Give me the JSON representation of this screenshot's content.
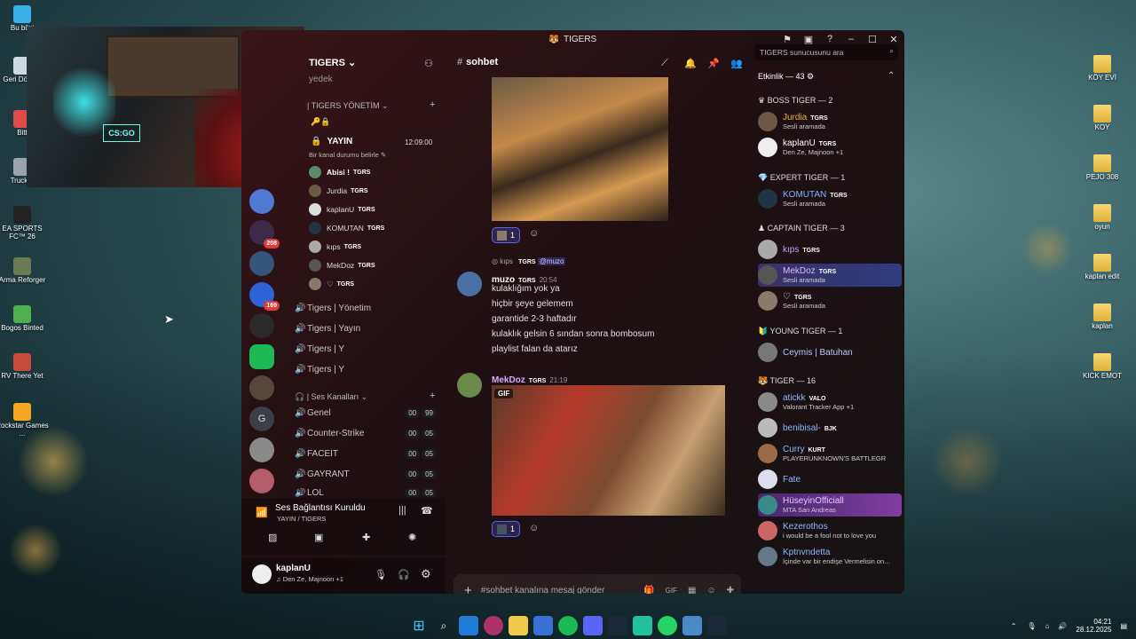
{
  "desktop": {
    "left_icons": [
      "Bu bilgi",
      "Geri Dönü...",
      "Bitt",
      "Trucker",
      "EA SPORTS FC™ 26",
      "Arma Reforger",
      "Bogos Binted",
      "RV There Yet",
      "Rockstar Games ..."
    ],
    "right_icons": [
      "KÖY EVİ",
      "KOY",
      "PEJO 308",
      "oyun",
      "kaplan edit",
      "kaplan",
      "KICK EMOT"
    ]
  },
  "webcam": {
    "logo": "CS:GO"
  },
  "window": {
    "title": "TIGERS"
  },
  "servers": {
    "badges": [
      "208",
      "169"
    ],
    "letter": "G"
  },
  "channels": {
    "server_name": "TIGERS",
    "prev_channel": "yedek",
    "category_1": "TIGERS YÖNETİM",
    "live_title": "YAYIN",
    "live_time": "12:09:00",
    "live_status": "Bir kanal durumu belirle",
    "voice_users": [
      {
        "name": "Abisi !",
        "tag": "TGRS"
      },
      {
        "name": "Jurdia",
        "tag": "TGRS"
      },
      {
        "name": "kaplanU",
        "tag": "TGRS"
      },
      {
        "name": "KOMUTAN",
        "tag": "TGRS"
      },
      {
        "name": "kıps",
        "tag": "TGRS"
      },
      {
        "name": "MekDoz",
        "tag": "TGRS"
      },
      {
        "name": "♡",
        "tag": "TGRS"
      }
    ],
    "voice_channels": [
      "Tigers | Yönetim",
      "Tigers | Yayın",
      "Tigers | Y",
      "Tigers | Y"
    ],
    "category_2": "Ses Kanalları",
    "sound_channels": [
      {
        "name": "Genel",
        "a": "00",
        "b": "99"
      },
      {
        "name": "Counter-Strike",
        "a": "00",
        "b": "05"
      },
      {
        "name": "FACEIT",
        "a": "00",
        "b": "05"
      },
      {
        "name": "GAYRANT",
        "a": "00",
        "b": "05"
      },
      {
        "name": "LOL",
        "a": "00",
        "b": "05"
      }
    ]
  },
  "voice_panel": {
    "title": "Ses Bağlantısı Kuruldu",
    "sub": "YAYIN / TIGERS"
  },
  "user_panel": {
    "name": "kaplanU",
    "status": "Den Ze, Majnoon +1"
  },
  "chat": {
    "channel": "sohbet",
    "search_placeholder": "TIGERS sunucusunu ara",
    "reaction1": "1",
    "reply_author": "kıps",
    "reply_tag": "TGRS",
    "reply_mention": "@muzo",
    "msg1": {
      "author": "muzo",
      "tag": "TGRS",
      "time": "20:54",
      "lines": [
        "kulaklığım yok ya",
        "hiçbir şeye gelemem",
        "garantide 2-3 haftadır",
        "kulaklık gelsin 6 sından sonra bombosum",
        "playlist falan da atarız"
      ]
    },
    "msg2": {
      "author": "MekDoz",
      "tag": "TGRS",
      "time": "21:19",
      "gif": "GIF"
    },
    "reaction2": "1",
    "composer_placeholder": "#sohbet kanalına mesaj gönder"
  },
  "members": {
    "header": "Etkinlik — 43",
    "groups": [
      {
        "title": "BOSS TIGER — 2",
        "members": [
          {
            "name": "Jurdia",
            "tag": "TGRS",
            "status": "Sesli aramada",
            "color": "#f0b232"
          },
          {
            "name": "kaplanU",
            "tag": "TGRS",
            "status": "Den Ze, Majnoon +1",
            "color": "#ffffff"
          }
        ]
      },
      {
        "title": "EXPERT TIGER — 1",
        "members": [
          {
            "name": "KOMUTAN",
            "tag": "TGRS",
            "status": "Sesli aramada",
            "color": "#7fb4ff"
          }
        ]
      },
      {
        "title": "CAPTAIN TIGER — 3",
        "members": [
          {
            "name": "kıps",
            "tag": "TGRS",
            "status": "",
            "color": "#c9a0ff"
          },
          {
            "name": "MekDoz",
            "tag": "TGRS",
            "status": "Sesli aramada",
            "color": "#c9a0ff"
          },
          {
            "name": "♡",
            "tag": "TGRS",
            "status": "Sesli aramada",
            "color": "#ffffff"
          }
        ]
      },
      {
        "title": "YOUNG TIGER — 1",
        "members": [
          {
            "name": "Ceymis | Batuhan",
            "tag": "",
            "status": "",
            "color": "#b5c7ff"
          }
        ]
      },
      {
        "title": "TIGER — 16",
        "members": [
          {
            "name": "atickk",
            "tag": "VALO",
            "status": "Valorant Tracker App +1",
            "color": "#8fb7ff"
          },
          {
            "name": "benibisal-",
            "tag": "BJK",
            "status": "",
            "color": "#8fb7ff"
          },
          {
            "name": "Curry",
            "tag": "KURT",
            "status": "PLAYERUNKNOWN'S BATTLEGR",
            "color": "#8fb7ff"
          },
          {
            "name": "Fate",
            "tag": "",
            "status": "",
            "color": "#8fb7ff"
          },
          {
            "name": "HüseyinOfficiall",
            "tag": "",
            "status": "MTA San Andreas",
            "color": "#d9b3ff"
          },
          {
            "name": "Kezerothos",
            "tag": "",
            "status": "i would be a fool not to love you",
            "color": "#8fb7ff"
          },
          {
            "name": "Kptnvndetta",
            "tag": "",
            "status": "İçinde var bir endişe Vermelisin on...",
            "color": "#8fb7ff"
          }
        ]
      }
    ]
  },
  "taskbar": {
    "time": "04:21",
    "date": "28.12.2025"
  }
}
